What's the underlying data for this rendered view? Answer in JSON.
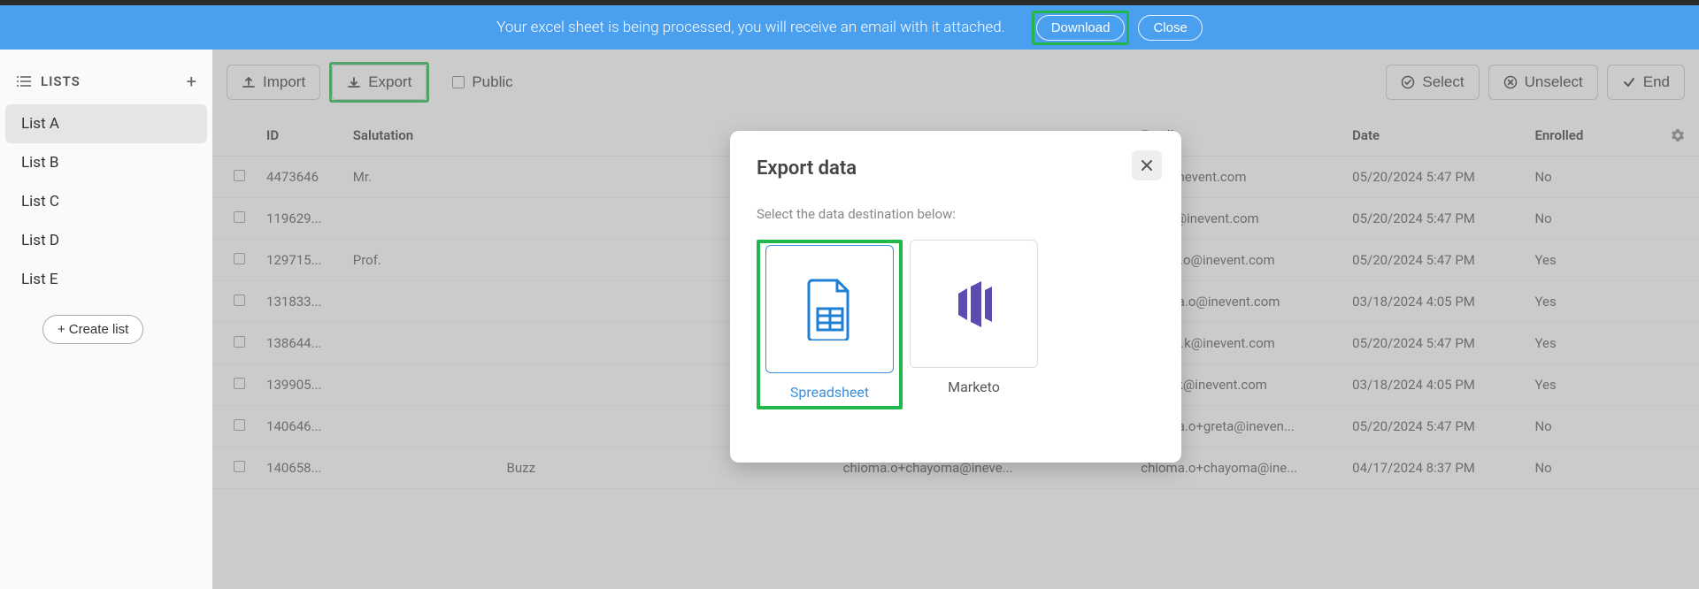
{
  "banner": {
    "message": "Your excel sheet is being processed, you will receive an email with it attached.",
    "download": "Download",
    "close": "Close"
  },
  "sidebar": {
    "title": "LISTS",
    "items": [
      "List A",
      "List B",
      "List C",
      "List D",
      "List E"
    ],
    "create": "Create list"
  },
  "toolbar": {
    "import": "Import",
    "export": "Export",
    "public": "Public",
    "select": "Select",
    "unselect": "Unselect",
    "end": "End"
  },
  "table": {
    "headers": {
      "id": "ID",
      "salutation": "Salutation",
      "col3": "",
      "col4": "",
      "email": "Email",
      "date": "Date",
      "enrolled": "Enrolled"
    },
    "rows": [
      {
        "id": "4473646",
        "salutation": "Mr.",
        "col3": "",
        "col4": "",
        "email": "ash@inevent.com",
        "date": "05/20/2024 5:47 PM",
        "enrolled": "No"
      },
      {
        "id": "119629...",
        "salutation": "",
        "col3": "",
        "col4": "",
        "email": "alfred@inevent.com",
        "date": "05/20/2024 5:47 PM",
        "enrolled": "No"
      },
      {
        "id": "129715...",
        "salutation": "Prof.",
        "col3": "",
        "col4": "",
        "email": "bissen.o@inevent.com",
        "date": "05/20/2024 5:47 PM",
        "enrolled": "Yes"
      },
      {
        "id": "131833...",
        "salutation": "",
        "col3": "",
        "col4": "",
        "email": "chioma.o@inevent.com",
        "date": "03/18/2024 4:05 PM",
        "enrolled": "Yes"
      },
      {
        "id": "138644...",
        "salutation": "",
        "col3": "",
        "col4": "",
        "email": "amalia.k@inevent.com",
        "date": "05/20/2024 5:47 PM",
        "enrolled": "Yes"
      },
      {
        "id": "139905...",
        "salutation": "",
        "col3": "",
        "col4": "",
        "email": "caleb.k@inevent.com",
        "date": "03/18/2024 4:05 PM",
        "enrolled": "Yes"
      },
      {
        "id": "140646...",
        "salutation": "",
        "col3": "",
        "col4": "...",
        "email": "chioma.o+greta@ineven...",
        "date": "05/20/2024 5:47 PM",
        "enrolled": "No"
      },
      {
        "id": "140658...",
        "salutation": "",
        "col3": "Buzz",
        "col4": "chioma.o+chayoma@ineve...",
        "email": "chioma.o+chayoma@ine...",
        "date": "04/17/2024 8:37 PM",
        "enrolled": "No"
      }
    ]
  },
  "modal": {
    "title": "Export data",
    "subtitle": "Select the data destination below:",
    "spreadsheet": "Spreadsheet",
    "marketo": "Marketo"
  }
}
